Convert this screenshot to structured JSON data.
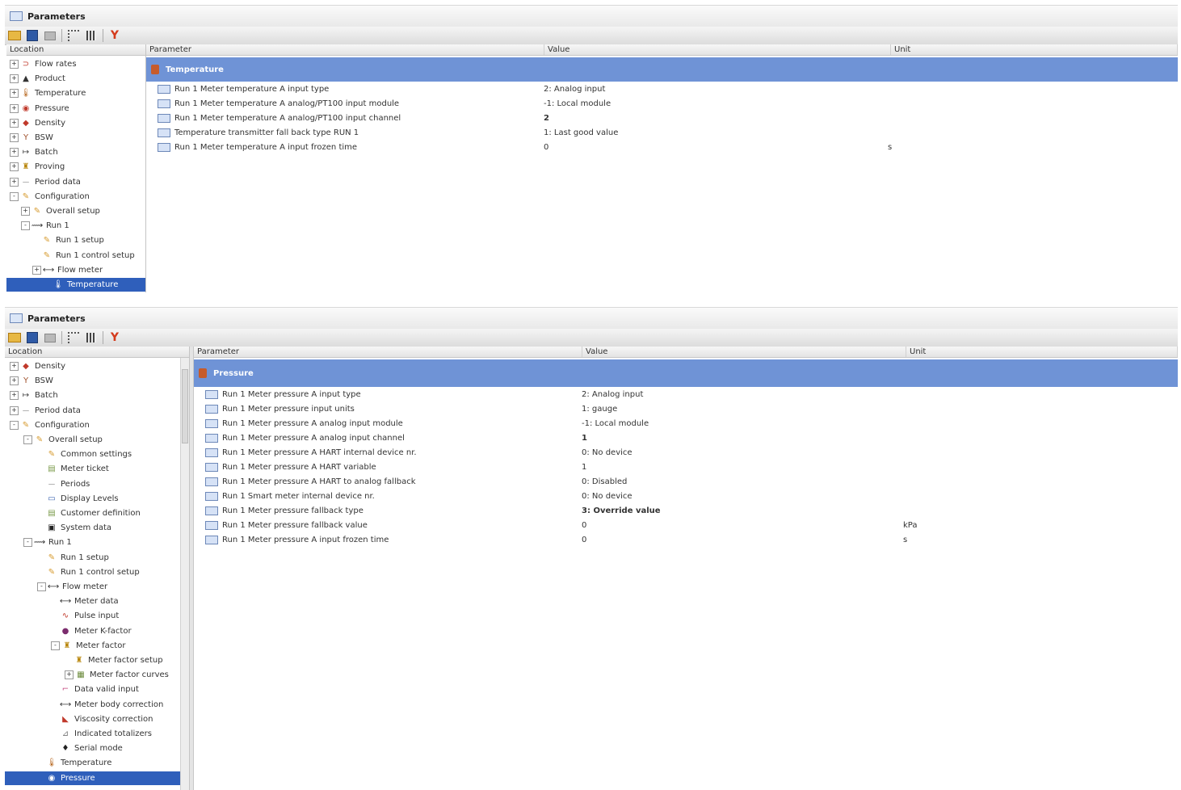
{
  "top": {
    "title": "Parameters",
    "location_header": "Location",
    "columns": [
      "Parameter",
      "Value",
      "Unit"
    ],
    "tree": [
      {
        "label": "Flow rates",
        "level": 0,
        "exp": "+",
        "icon": "flow-icon"
      },
      {
        "label": "Product",
        "level": 0,
        "exp": "+",
        "icon": "product-icon"
      },
      {
        "label": "Temperature",
        "level": 0,
        "exp": "+",
        "icon": "thermometer-icon"
      },
      {
        "label": "Pressure",
        "level": 0,
        "exp": "+",
        "icon": "gauge-icon"
      },
      {
        "label": "Density",
        "level": 0,
        "exp": "+",
        "icon": "density-icon"
      },
      {
        "label": "BSW",
        "level": 0,
        "exp": "+",
        "icon": "funnel-icon"
      },
      {
        "label": "Batch",
        "level": 0,
        "exp": "+",
        "icon": "batch-icon"
      },
      {
        "label": "Proving",
        "level": 0,
        "exp": "+",
        "icon": "proving-icon"
      },
      {
        "label": "Period data",
        "level": 0,
        "exp": "+",
        "icon": "period-icon"
      },
      {
        "label": "Configuration",
        "level": 0,
        "exp": "-",
        "icon": "config-icon"
      },
      {
        "label": "Overall setup",
        "level": 1,
        "exp": "+",
        "icon": "config-icon"
      },
      {
        "label": "Run 1",
        "level": 1,
        "exp": "-",
        "icon": "run-icon"
      },
      {
        "label": "Run 1 setup",
        "level": 2,
        "exp": "",
        "icon": "config-icon"
      },
      {
        "label": "Run 1 control setup",
        "level": 2,
        "exp": "",
        "icon": "config-icon"
      },
      {
        "label": "Flow meter",
        "level": 2,
        "exp": "+",
        "icon": "flow-meter-icon"
      },
      {
        "label": "Temperature",
        "level": 3,
        "exp": "",
        "icon": "thermometer-icon",
        "selected": true
      }
    ],
    "group": "Temperature",
    "rows": [
      {
        "param": "Run 1 Meter temperature A input type",
        "value": "2: Analog input",
        "unit": ""
      },
      {
        "param": "Run 1 Meter temperature A analog/PT100 input module",
        "value": "-1: Local module",
        "unit": ""
      },
      {
        "param": "Run 1 Meter temperature A analog/PT100 input channel",
        "value": "2",
        "unit": "",
        "bold": true
      },
      {
        "param": "Temperature transmitter fall back type RUN 1",
        "value": "1: Last good value",
        "unit": ""
      },
      {
        "param": "Run 1 Meter temperature A input frozen time",
        "value": "0",
        "unit": "s"
      }
    ]
  },
  "bottom": {
    "title": "Parameters",
    "location_header": "Location",
    "columns": [
      "Parameter",
      "Value",
      "Unit"
    ],
    "tree": [
      {
        "label": "Density",
        "level": 0,
        "exp": "+",
        "icon": "density-icon"
      },
      {
        "label": "BSW",
        "level": 0,
        "exp": "+",
        "icon": "funnel-icon"
      },
      {
        "label": "Batch",
        "level": 0,
        "exp": "+",
        "icon": "batch-icon"
      },
      {
        "label": "Period data",
        "level": 0,
        "exp": "+",
        "icon": "period-icon"
      },
      {
        "label": "Configuration",
        "level": 0,
        "exp": "-",
        "icon": "config-icon"
      },
      {
        "label": "Overall setup",
        "level": 1,
        "exp": "-",
        "icon": "config-icon"
      },
      {
        "label": "Common settings",
        "level": 2,
        "exp": "",
        "icon": "config-icon"
      },
      {
        "label": "Meter ticket",
        "level": 2,
        "exp": "",
        "icon": "ticket-icon"
      },
      {
        "label": "Periods",
        "level": 2,
        "exp": "",
        "icon": "period-icon"
      },
      {
        "label": "Display Levels",
        "level": 2,
        "exp": "",
        "icon": "display-icon"
      },
      {
        "label": "Customer definition",
        "level": 2,
        "exp": "",
        "icon": "ticket-icon"
      },
      {
        "label": "System data",
        "level": 2,
        "exp": "",
        "icon": "system-icon"
      },
      {
        "label": "Run 1",
        "level": 1,
        "exp": "-",
        "icon": "run-icon"
      },
      {
        "label": "Run 1 setup",
        "level": 2,
        "exp": "",
        "icon": "config-icon"
      },
      {
        "label": "Run 1 control setup",
        "level": 2,
        "exp": "",
        "icon": "config-icon"
      },
      {
        "label": "Flow meter",
        "level": 2,
        "exp": "-",
        "icon": "flow-meter-icon"
      },
      {
        "label": "Meter data",
        "level": 3,
        "exp": "",
        "icon": "flow-meter-icon"
      },
      {
        "label": "Pulse input",
        "level": 3,
        "exp": "",
        "icon": "pulse-icon"
      },
      {
        "label": "Meter K-factor",
        "level": 3,
        "exp": "",
        "icon": "kfactor-icon"
      },
      {
        "label": "Meter factor",
        "level": 3,
        "exp": "-",
        "icon": "proving-icon"
      },
      {
        "label": "Meter factor setup",
        "level": 4,
        "exp": "",
        "icon": "proving-icon"
      },
      {
        "label": "Meter factor curves",
        "level": 4,
        "exp": "+",
        "icon": "curve-icon"
      },
      {
        "label": "Data valid input",
        "level": 3,
        "exp": "",
        "icon": "data-valid-icon"
      },
      {
        "label": "Meter body correction",
        "level": 3,
        "exp": "",
        "icon": "flow-meter-icon"
      },
      {
        "label": "Viscosity correction",
        "level": 3,
        "exp": "",
        "icon": "viscosity-icon"
      },
      {
        "label": "Indicated totalizers",
        "level": 3,
        "exp": "",
        "icon": "totalizer-icon"
      },
      {
        "label": "Serial mode",
        "level": 3,
        "exp": "",
        "icon": "serial-icon"
      },
      {
        "label": "Temperature",
        "level": 2,
        "exp": "",
        "icon": "thermometer-icon"
      },
      {
        "label": "Pressure",
        "level": 2,
        "exp": "",
        "icon": "gauge-icon",
        "selected": true
      }
    ],
    "group": "Pressure",
    "rows": [
      {
        "param": "Run 1 Meter pressure A input type",
        "value": "2: Analog input",
        "unit": ""
      },
      {
        "param": "Run 1 Meter pressure input units",
        "value": "1: gauge",
        "unit": ""
      },
      {
        "param": "Run 1 Meter pressure A analog input module",
        "value": "-1: Local module",
        "unit": ""
      },
      {
        "param": "Run 1 Meter pressure A analog input channel",
        "value": "1",
        "unit": "",
        "bold": true
      },
      {
        "param": "Run 1 Meter pressure A HART internal device nr.",
        "value": "0: No device",
        "unit": ""
      },
      {
        "param": "Run 1 Meter pressure A HART variable",
        "value": "1",
        "unit": ""
      },
      {
        "param": "Run 1 Meter pressure A HART to analog fallback",
        "value": "0: Disabled",
        "unit": ""
      },
      {
        "param": "Run 1 Smart meter internal device nr.",
        "value": "0: No device",
        "unit": ""
      },
      {
        "param": "Run 1 Meter pressure fallback type",
        "value": "3: Override value",
        "unit": "",
        "bold": true
      },
      {
        "param": "Run 1 Meter pressure fallback value",
        "value": "0",
        "unit": "kPa"
      },
      {
        "param": "Run 1 Meter pressure A input frozen time",
        "value": "0",
        "unit": "s"
      }
    ]
  },
  "icons": {
    "flow-icon": "⊃",
    "product-icon": "▲",
    "thermometer-icon": "🌡",
    "gauge-icon": "◉",
    "density-icon": "◆",
    "funnel-icon": "Y",
    "batch-icon": "↦",
    "proving-icon": "♜",
    "period-icon": "⏤",
    "config-icon": "✎",
    "run-icon": "⟿",
    "flow-meter-icon": "⟷",
    "ticket-icon": "▤",
    "display-icon": "▭",
    "system-icon": "▣",
    "pulse-icon": "∿",
    "kfactor-icon": "●",
    "curve-icon": "▦",
    "data-valid-icon": "⌐",
    "viscosity-icon": "◣",
    "totalizer-icon": "⊿",
    "serial-icon": "♦"
  },
  "icon_colors": {
    "flow-icon": "#c0392b",
    "product-icon": "#333333",
    "thermometer-icon": "#b5651d",
    "gauge-icon": "#c0392b",
    "density-icon": "#c0392b",
    "funnel-icon": "#a0522d",
    "batch-icon": "#444444",
    "proving-icon": "#b8860b",
    "period-icon": "#666666",
    "config-icon": "#d69a2d",
    "run-icon": "#333333",
    "flow-meter-icon": "#333333",
    "ticket-icon": "#7a9a4a",
    "display-icon": "#3a62b0",
    "system-icon": "#222222",
    "pulse-icon": "#c0392b",
    "kfactor-icon": "#7b2c6d",
    "curve-icon": "#6a8a3a",
    "data-valid-icon": "#c2417a",
    "viscosity-icon": "#c0392b",
    "totalizer-icon": "#777777",
    "serial-icon": "#222222"
  }
}
